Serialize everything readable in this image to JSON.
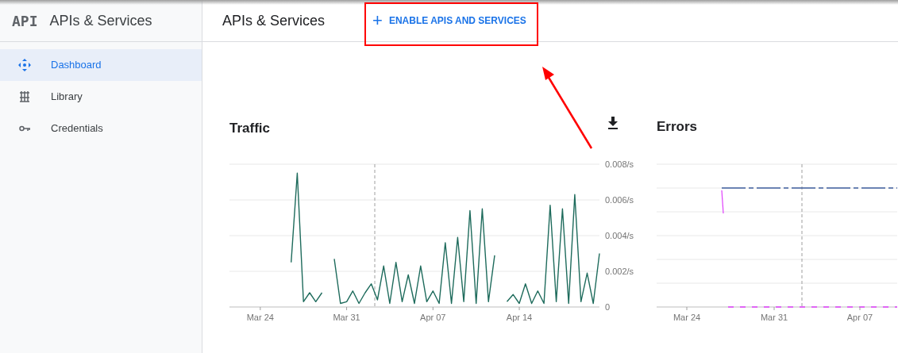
{
  "sidebar": {
    "logo": "API",
    "title": "APIs & Services",
    "items": [
      {
        "label": "Dashboard",
        "selected": true,
        "kind": "dashboard"
      },
      {
        "label": "Library",
        "selected": false,
        "kind": "library"
      },
      {
        "label": "Credentials",
        "selected": false,
        "kind": "credentials"
      }
    ]
  },
  "header": {
    "title": "APIs & Services",
    "action": {
      "icon": "+",
      "label": "ENABLE APIS AND SERVICES"
    }
  },
  "traffic": {
    "title": "Traffic",
    "chart_data": {
      "type": "line",
      "grid": true,
      "ylim": [
        0,
        0.008
      ],
      "yticks": [
        {
          "value": 0,
          "label": "0"
        },
        {
          "value": 0.002,
          "label": "0.002/s"
        },
        {
          "value": 0.004,
          "label": "0.004/s"
        },
        {
          "value": 0.006,
          "label": "0.006/s"
        },
        {
          "value": 0.008,
          "label": "0.008/s"
        }
      ],
      "categories": [
        null,
        null,
        null,
        null,
        null,
        "Mar 24",
        null,
        null,
        null,
        null,
        null,
        null,
        null,
        null,
        null,
        null,
        null,
        null,
        null,
        "Mar 31",
        null,
        null,
        null,
        null,
        null,
        null,
        null,
        null,
        null,
        null,
        null,
        null,
        null,
        "Apr 07",
        null,
        null,
        null,
        null,
        null,
        null,
        null,
        null,
        null,
        null,
        null,
        null,
        null,
        "Apr 14",
        null,
        null,
        null,
        null,
        null,
        null,
        null,
        null,
        null,
        null,
        null,
        null,
        null
      ],
      "values": [
        null,
        null,
        null,
        null,
        null,
        null,
        null,
        null,
        null,
        null,
        0.0025,
        0.0075,
        0.0003,
        0.0008,
        0.0003,
        0.0008,
        null,
        0.0027,
        0.0002,
        0.0003,
        0.0009,
        0.0002,
        0.0008,
        0.0013,
        0.0004,
        0.0023,
        0.0002,
        0.0025,
        0.0003,
        0.0018,
        0.0002,
        0.0023,
        0.0003,
        0.0009,
        0.0002,
        0.0036,
        0.0002,
        0.0039,
        0.0003,
        0.0054,
        0.0002,
        0.0055,
        0.0003,
        0.0029,
        null,
        0.0003,
        0.0007,
        0.0002,
        0.0013,
        0.0002,
        0.0009,
        0.0002,
        0.0057,
        0.0003,
        0.0055,
        0.0002,
        0.0063,
        0.0003,
        0.0019,
        0.0002,
        0.003
      ]
    }
  },
  "errors": {
    "title": "Errors",
    "xlabels": [
      "Mar 24",
      "Mar 31",
      "Apr 07"
    ]
  }
}
